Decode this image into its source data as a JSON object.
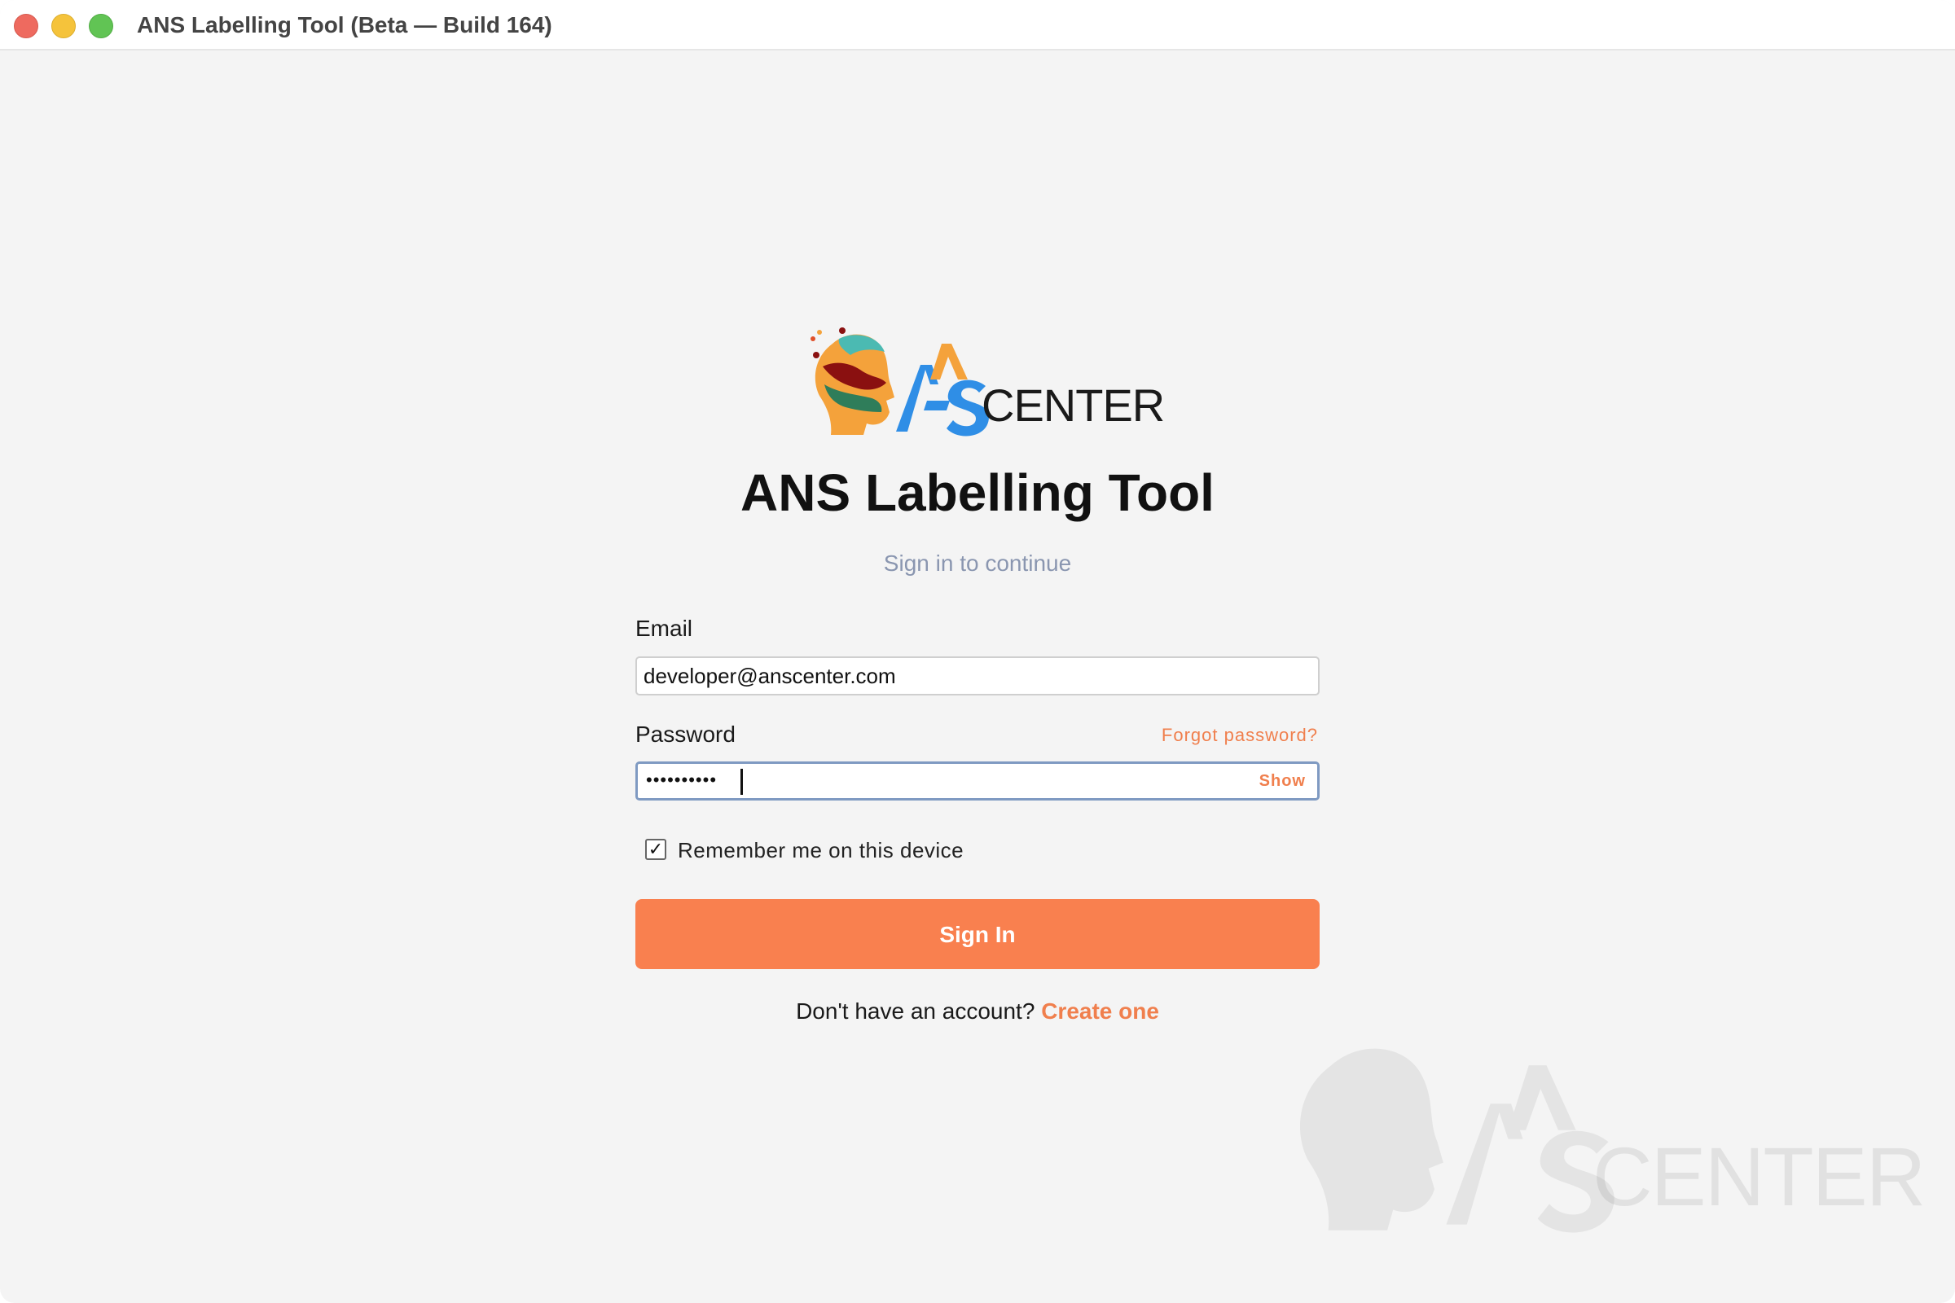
{
  "window": {
    "title": "ANS Labelling Tool (Beta — Build 164)"
  },
  "brand": {
    "logo_text": "CENTER",
    "colors": {
      "orange": "#f4a23b",
      "blue": "#2f8ee6",
      "teal": "#4bbab2",
      "dark_red": "#8a1010",
      "green": "#2f7d5a"
    }
  },
  "login": {
    "title": "ANS Labelling Tool",
    "subtitle": "Sign in to continue",
    "email_label": "Email",
    "email_value": "developer@anscenter.com",
    "password_label": "Password",
    "forgot_label": "Forgot password?",
    "password_mask": "••••••••••",
    "show_label": "Show",
    "remember_label": "Remember me on this device",
    "remember_checked": true,
    "check_glyph": "✓",
    "signin_label": "Sign In",
    "signup_prompt": "Don't have an account?",
    "signup_link": "Create one"
  },
  "theme": {
    "accent": "#f9804f",
    "background": "#f4f4f4"
  }
}
